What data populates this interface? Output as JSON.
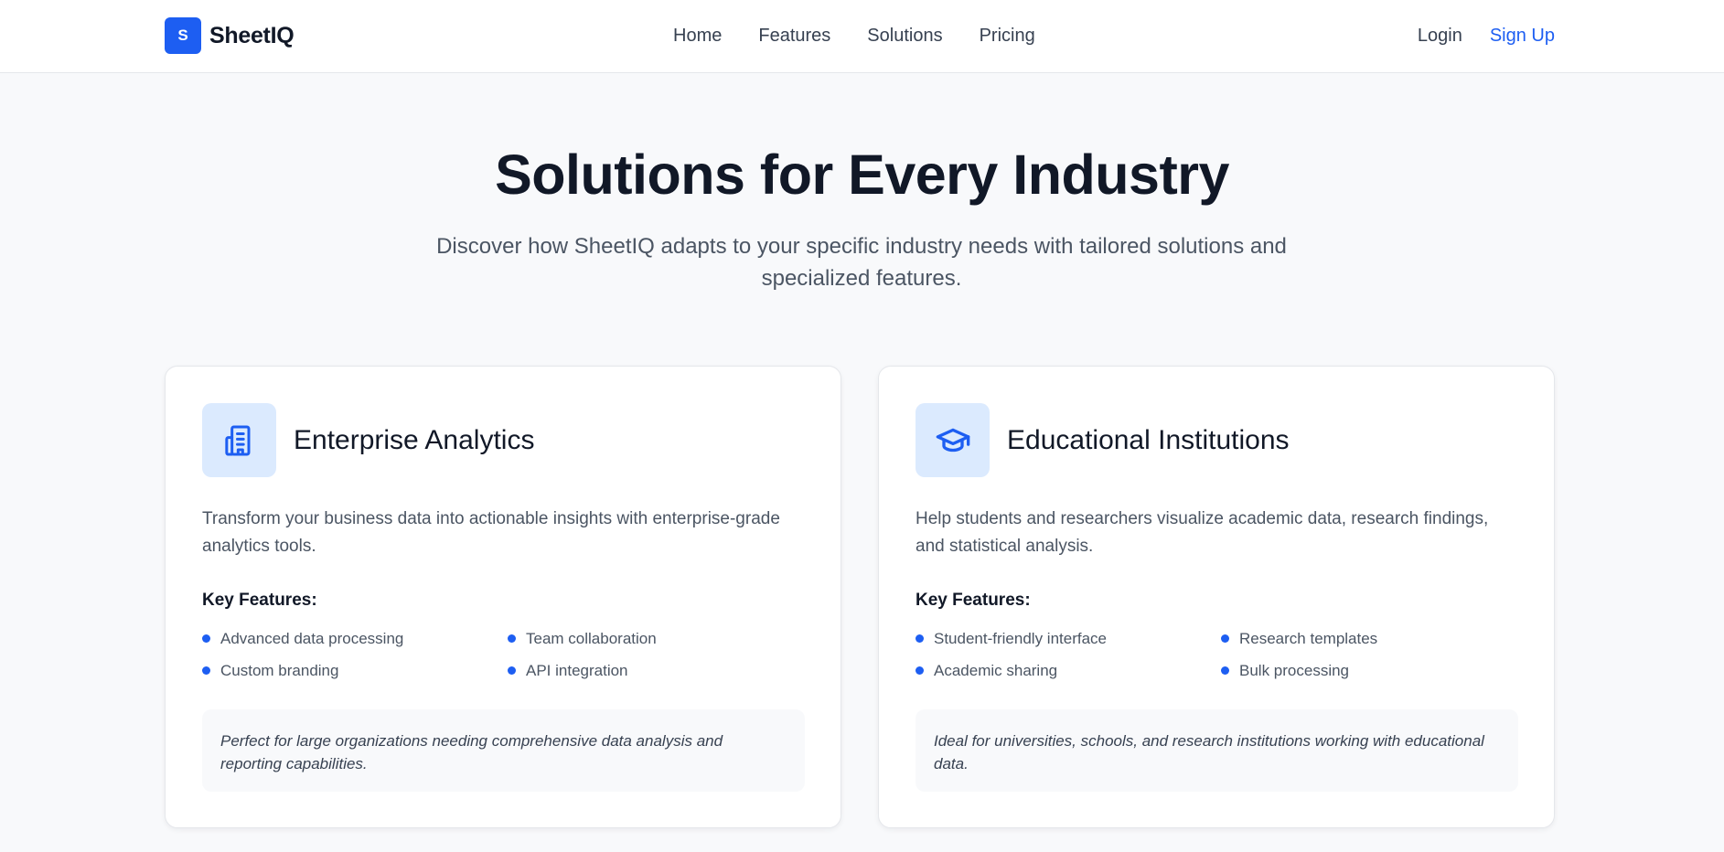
{
  "header": {
    "logo_letter": "S",
    "brand": "SheetIQ",
    "nav": [
      "Home",
      "Features",
      "Solutions",
      "Pricing"
    ],
    "login": "Login",
    "signup": "Sign Up"
  },
  "hero": {
    "title": "Solutions for Every Industry",
    "subtitle": "Discover how SheetIQ adapts to your specific industry needs with tailored solutions and specialized features."
  },
  "cards": [
    {
      "icon": "building-icon",
      "title": "Enterprise Analytics",
      "description": "Transform your business data into actionable insights with enterprise-grade analytics tools.",
      "features_label": "Key Features:",
      "features": [
        "Advanced data processing",
        "Team collaboration",
        "Custom branding",
        "API integration"
      ],
      "note": "Perfect for large organizations needing comprehensive data analysis and reporting capabilities."
    },
    {
      "icon": "graduation-cap-icon",
      "title": "Educational Institutions",
      "description": "Help students and researchers visualize academic data, research findings, and statistical analysis.",
      "features_label": "Key Features:",
      "features": [
        "Student-friendly interface",
        "Research templates",
        "Academic sharing",
        "Bulk processing"
      ],
      "note": "Ideal for universities, schools, and research institutions working with educational data."
    }
  ],
  "colors": {
    "accent": "#1d5ef2",
    "icon_bg": "#dbeafe",
    "page_bg": "#f8f9fb",
    "heading": "#111827",
    "body_text": "#4b5563"
  }
}
